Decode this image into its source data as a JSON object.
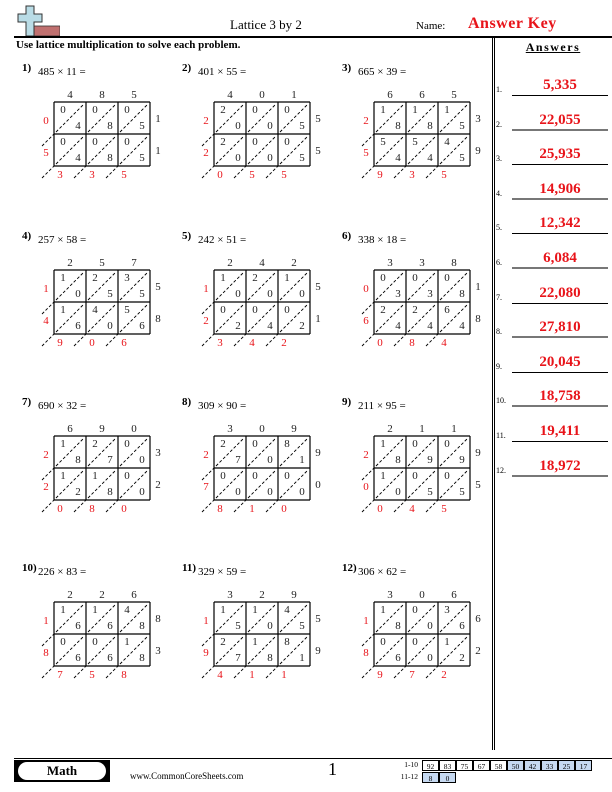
{
  "header": {
    "title": "Lattice 3 by 2",
    "name_label": "Name:",
    "name_value": "Answer Key",
    "instructions": "Use lattice multiplication to solve each problem."
  },
  "answers": {
    "title": "Answers",
    "items": [
      {
        "num": "1.",
        "value": "5,335"
      },
      {
        "num": "2.",
        "value": "22,055"
      },
      {
        "num": "3.",
        "value": "25,935"
      },
      {
        "num": "4.",
        "value": "14,906"
      },
      {
        "num": "5.",
        "value": "12,342"
      },
      {
        "num": "6.",
        "value": "6,084"
      },
      {
        "num": "7.",
        "value": "22,080"
      },
      {
        "num": "8.",
        "value": "27,810"
      },
      {
        "num": "9.",
        "value": "20,045"
      },
      {
        "num": "10.",
        "value": "18,758"
      },
      {
        "num": "11.",
        "value": "19,411"
      },
      {
        "num": "12.",
        "value": "18,972"
      }
    ]
  },
  "problems": [
    {
      "label": "1)",
      "expr": "485 × 11 =",
      "top": [
        "4",
        "8",
        "5"
      ],
      "right": [
        "1",
        "1"
      ],
      "cells": [
        [
          [
            "0",
            "4"
          ],
          [
            "0",
            "8"
          ],
          [
            "0",
            "5"
          ]
        ],
        [
          [
            "0",
            "4"
          ],
          [
            "0",
            "8"
          ],
          [
            "0",
            "5"
          ]
        ]
      ],
      "left": [
        "0",
        "5"
      ],
      "bottom": [
        "3",
        "3",
        "5"
      ]
    },
    {
      "label": "2)",
      "expr": "401 × 55 =",
      "top": [
        "4",
        "0",
        "1"
      ],
      "right": [
        "5",
        "5"
      ],
      "cells": [
        [
          [
            "2",
            "0"
          ],
          [
            "0",
            "0"
          ],
          [
            "0",
            "5"
          ]
        ],
        [
          [
            "2",
            "0"
          ],
          [
            "0",
            "0"
          ],
          [
            "0",
            "5"
          ]
        ]
      ],
      "left": [
        "2",
        "2"
      ],
      "bottom": [
        "0",
        "5",
        "5"
      ]
    },
    {
      "label": "3)",
      "expr": "665 × 39 =",
      "top": [
        "6",
        "6",
        "5"
      ],
      "right": [
        "3",
        "9"
      ],
      "cells": [
        [
          [
            "1",
            "8"
          ],
          [
            "1",
            "8"
          ],
          [
            "1",
            "5"
          ]
        ],
        [
          [
            "5",
            "4"
          ],
          [
            "5",
            "4"
          ],
          [
            "4",
            "5"
          ]
        ]
      ],
      "left": [
        "2",
        "5"
      ],
      "bottom": [
        "9",
        "3",
        "5"
      ]
    },
    {
      "label": "4)",
      "expr": "257 × 58 =",
      "top": [
        "2",
        "5",
        "7"
      ],
      "right": [
        "5",
        "8"
      ],
      "cells": [
        [
          [
            "1",
            "0"
          ],
          [
            "2",
            "5"
          ],
          [
            "3",
            "5"
          ]
        ],
        [
          [
            "1",
            "6"
          ],
          [
            "4",
            "0"
          ],
          [
            "5",
            "6"
          ]
        ]
      ],
      "left": [
        "1",
        "4"
      ],
      "bottom": [
        "9",
        "0",
        "6"
      ]
    },
    {
      "label": "5)",
      "expr": "242 × 51 =",
      "top": [
        "2",
        "4",
        "2"
      ],
      "right": [
        "5",
        "1"
      ],
      "cells": [
        [
          [
            "1",
            "0"
          ],
          [
            "2",
            "0"
          ],
          [
            "1",
            "0"
          ]
        ],
        [
          [
            "0",
            "2"
          ],
          [
            "0",
            "4"
          ],
          [
            "0",
            "2"
          ]
        ]
      ],
      "left": [
        "1",
        "2"
      ],
      "bottom": [
        "3",
        "4",
        "2"
      ]
    },
    {
      "label": "6)",
      "expr": "338 × 18 =",
      "top": [
        "3",
        "3",
        "8"
      ],
      "right": [
        "1",
        "8"
      ],
      "cells": [
        [
          [
            "0",
            "3"
          ],
          [
            "0",
            "3"
          ],
          [
            "0",
            "8"
          ]
        ],
        [
          [
            "2",
            "4"
          ],
          [
            "2",
            "4"
          ],
          [
            "6",
            "4"
          ]
        ]
      ],
      "left": [
        "0",
        "6"
      ],
      "bottom": [
        "0",
        "8",
        "4"
      ]
    },
    {
      "label": "7)",
      "expr": "690 × 32 =",
      "top": [
        "6",
        "9",
        "0"
      ],
      "right": [
        "3",
        "2"
      ],
      "cells": [
        [
          [
            "1",
            "8"
          ],
          [
            "2",
            "7"
          ],
          [
            "0",
            "0"
          ]
        ],
        [
          [
            "1",
            "2"
          ],
          [
            "1",
            "8"
          ],
          [
            "0",
            "0"
          ]
        ]
      ],
      "left": [
        "2",
        "2"
      ],
      "bottom": [
        "0",
        "8",
        "0"
      ]
    },
    {
      "label": "8)",
      "expr": "309 × 90 =",
      "top": [
        "3",
        "0",
        "9"
      ],
      "right": [
        "9",
        "0"
      ],
      "cells": [
        [
          [
            "2",
            "7"
          ],
          [
            "0",
            "0"
          ],
          [
            "8",
            "1"
          ]
        ],
        [
          [
            "0",
            "0"
          ],
          [
            "0",
            "0"
          ],
          [
            "0",
            "0"
          ]
        ]
      ],
      "left": [
        "2",
        "7"
      ],
      "bottom": [
        "8",
        "1",
        "0"
      ]
    },
    {
      "label": "9)",
      "expr": "211 × 95 =",
      "top": [
        "2",
        "1",
        "1"
      ],
      "right": [
        "9",
        "5"
      ],
      "cells": [
        [
          [
            "1",
            "8"
          ],
          [
            "0",
            "9"
          ],
          [
            "0",
            "9"
          ]
        ],
        [
          [
            "1",
            "0"
          ],
          [
            "0",
            "5"
          ],
          [
            "0",
            "5"
          ]
        ]
      ],
      "left": [
        "2",
        "0"
      ],
      "bottom": [
        "0",
        "4",
        "5"
      ]
    },
    {
      "label": "10)",
      "expr": "226 × 83 =",
      "top": [
        "2",
        "2",
        "6"
      ],
      "right": [
        "8",
        "3"
      ],
      "cells": [
        [
          [
            "1",
            "6"
          ],
          [
            "1",
            "6"
          ],
          [
            "4",
            "8"
          ]
        ],
        [
          [
            "0",
            "6"
          ],
          [
            "0",
            "6"
          ],
          [
            "1",
            "8"
          ]
        ]
      ],
      "left": [
        "1",
        "8"
      ],
      "bottom": [
        "7",
        "5",
        "8"
      ]
    },
    {
      "label": "11)",
      "expr": "329 × 59 =",
      "top": [
        "3",
        "2",
        "9"
      ],
      "right": [
        "5",
        "9"
      ],
      "cells": [
        [
          [
            "1",
            "5"
          ],
          [
            "1",
            "0"
          ],
          [
            "4",
            "5"
          ]
        ],
        [
          [
            "2",
            "7"
          ],
          [
            "1",
            "8"
          ],
          [
            "8",
            "1"
          ]
        ]
      ],
      "left": [
        "1",
        "9"
      ],
      "bottom": [
        "4",
        "1",
        "1"
      ]
    },
    {
      "label": "12)",
      "expr": "306 × 62 =",
      "top": [
        "3",
        "0",
        "6"
      ],
      "right": [
        "6",
        "2"
      ],
      "cells": [
        [
          [
            "1",
            "8"
          ],
          [
            "0",
            "0"
          ],
          [
            "3",
            "6"
          ]
        ],
        [
          [
            "0",
            "6"
          ],
          [
            "0",
            "0"
          ],
          [
            "1",
            "2"
          ]
        ]
      ],
      "left": [
        "1",
        "8"
      ],
      "bottom": [
        "9",
        "7",
        "2"
      ]
    }
  ],
  "footer": {
    "subject": "Math",
    "site": "www.CommonCoreSheets.com",
    "page": "1",
    "score_rows": [
      {
        "label": "1-10",
        "scores": [
          "92",
          "83",
          "75",
          "67",
          "58",
          "50",
          "42",
          "33",
          "25",
          "17"
        ]
      },
      {
        "label": "11-12",
        "scores": [
          "8",
          "0"
        ]
      }
    ]
  },
  "colors": {
    "answer_red": "#e8141a",
    "score_blue": "#c6d9f1"
  }
}
